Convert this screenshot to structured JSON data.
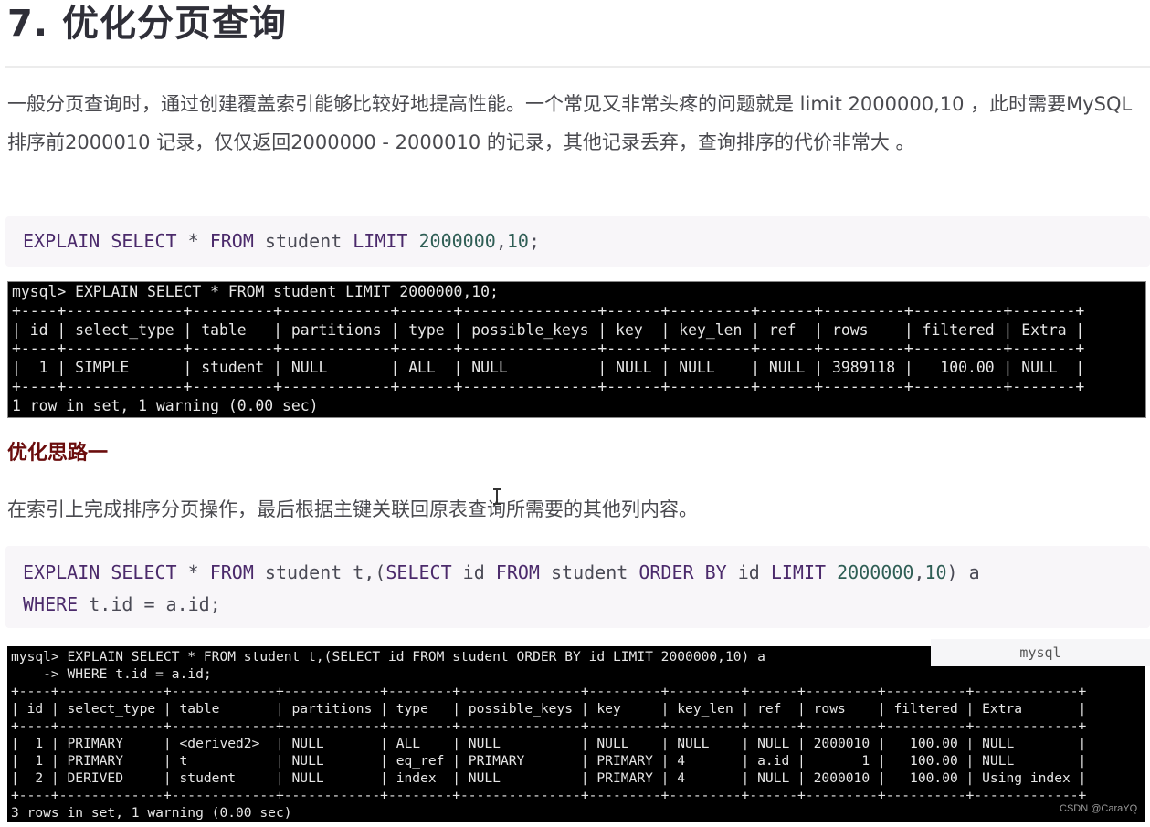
{
  "article": {
    "title": "7. 优化分页查询",
    "intro_paragraph": "一般分页查询时，通过创建覆盖索引能够比较好地提高性能。一个常见又非常头疼的问题就是 limit 2000000,10 ，此时需要MySQL排序前2000010 记录，仅仅返回2000000 - 2000010 的记录，其他记录丢弃，查询排序的代价非常大 。",
    "code1": {
      "tokens": [
        {
          "t": "EXPLAIN SELECT",
          "c": "kw"
        },
        {
          "t": " * ",
          "c": ""
        },
        {
          "t": "FROM",
          "c": "kw"
        },
        {
          "t": " student ",
          "c": ""
        },
        {
          "t": "LIMIT",
          "c": "kw"
        },
        {
          "t": " ",
          "c": ""
        },
        {
          "t": "2000000",
          "c": "num"
        },
        {
          "t": ",",
          "c": ""
        },
        {
          "t": "10",
          "c": "num"
        },
        {
          "t": ";",
          "c": ""
        }
      ]
    },
    "terminal1": {
      "lines": [
        "mysql> EXPLAIN SELECT * FROM student LIMIT 2000000,10;",
        "+----+-------------+---------+------------+------+---------------+------+---------+------+---------+----------+-------+",
        "| id | select_type | table   | partitions | type | possible_keys | key  | key_len | ref  | rows    | filtered | Extra |",
        "+----+-------------+---------+------------+------+---------------+------+---------+------+---------+----------+-------+",
        "|  1 | SIMPLE      | student | NULL       | ALL  | NULL          | NULL | NULL    | NULL | 3989118 |   100.00 | NULL  |",
        "+----+-------------+---------+------------+------+---------------+------+---------+------+---------+----------+-------+",
        "1 row in set, 1 warning (0.00 sec)"
      ]
    },
    "section_heading": "优化思路一",
    "section_paragraph": "在索引上完成排序分页操作，最后根据主键关联回原表查询所需要的其他列内容。",
    "code2": {
      "lines": [
        [
          {
            "t": "EXPLAIN SELECT",
            "c": "kw"
          },
          {
            "t": " * ",
            "c": ""
          },
          {
            "t": "FROM",
            "c": "kw"
          },
          {
            "t": " student t,(",
            "c": ""
          },
          {
            "t": "SELECT",
            "c": "kw"
          },
          {
            "t": " id ",
            "c": ""
          },
          {
            "t": "FROM",
            "c": "kw"
          },
          {
            "t": " student ",
            "c": ""
          },
          {
            "t": "ORDER BY",
            "c": "kw"
          },
          {
            "t": " id ",
            "c": ""
          },
          {
            "t": "LIMIT",
            "c": "kw"
          },
          {
            "t": " ",
            "c": ""
          },
          {
            "t": "2000000",
            "c": "num"
          },
          {
            "t": ",",
            "c": ""
          },
          {
            "t": "10",
            "c": "num"
          },
          {
            "t": ") a",
            "c": ""
          }
        ],
        [
          {
            "t": "WHERE",
            "c": "kw"
          },
          {
            "t": " t.id = a.id;",
            "c": ""
          }
        ]
      ]
    },
    "code2_lang_label": "mysql",
    "terminal2": {
      "lines": [
        "mysql> EXPLAIN SELECT * FROM student t,(SELECT id FROM student ORDER BY id LIMIT 2000000,10) a",
        "    -> WHERE t.id = a.id;",
        "+----+-------------+-------------+------------+--------+---------------+---------+---------+------+---------+----------+-------------+",
        "| id | select_type | table       | partitions | type   | possible_keys | key     | key_len | ref  | rows    | filtered | Extra       |",
        "+----+-------------+-------------+------------+--------+---------------+---------+---------+------+---------+----------+-------------+",
        "|  1 | PRIMARY     | <derived2>  | NULL       | ALL    | NULL          | NULL    | NULL    | NULL | 2000010 |   100.00 | NULL        |",
        "|  1 | PRIMARY     | t           | NULL       | eq_ref | PRIMARY       | PRIMARY | 4       | a.id |       1 |   100.00 | NULL        |",
        "|  2 | DERIVED     | student     | NULL       | index  | NULL          | PRIMARY | 4       | NULL | 2000010 |   100.00 | Using index |",
        "+----+-------------+-------------+------------+--------+---------------+---------+---------+------+---------+----------+-------------+",
        "3 rows in set, 1 warning (0.00 sec)"
      ]
    },
    "watermark": "CSDN @CaraYQ"
  },
  "colors": {
    "title": "#2f2f38",
    "section_heading": "#6b0d0d",
    "code_bg": "#f8f6f9",
    "code_keyword": "#4b2a6b",
    "code_number": "#2f5e55",
    "terminal_bg": "#000000",
    "terminal_fg": "#e6e6e6"
  }
}
